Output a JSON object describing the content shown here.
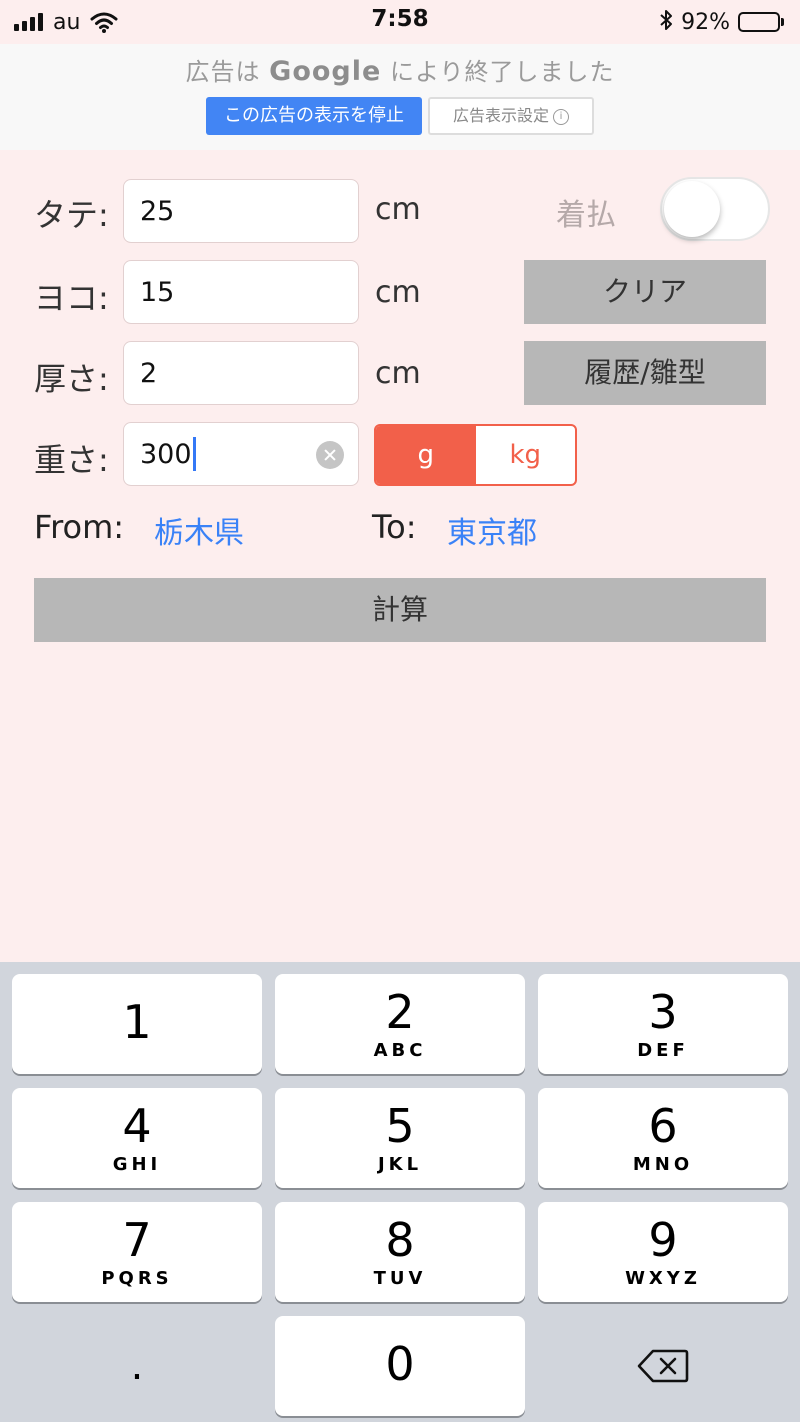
{
  "status_bar": {
    "carrier": "au",
    "time": "7:58",
    "battery_percent": "92%",
    "battery_level": 0.92
  },
  "ad": {
    "message_before": "広告は",
    "brand": "Google",
    "message_after": "により終了しました",
    "stop_button": "この広告の表示を停止",
    "settings_button": "広告表示設定",
    "info_glyph": "i"
  },
  "form": {
    "height": {
      "label": "タテ:",
      "value": "25",
      "unit": "cm"
    },
    "width": {
      "label": "ヨコ:",
      "value": "15",
      "unit": "cm"
    },
    "thickness": {
      "label": "厚さ:",
      "value": "2",
      "unit": "cm"
    },
    "weight": {
      "label": "重さ:",
      "value": "300"
    },
    "cash_on_delivery": {
      "label": "着払",
      "on": false
    },
    "clear_button": "クリア",
    "history_button": "履歴/雛型",
    "unit_toggle": {
      "options": [
        "g",
        "kg"
      ],
      "selected": "g"
    },
    "from_label": "From:",
    "from_value": "栃木県",
    "to_label": "To:",
    "to_value": "東京都",
    "calculate_button": "計算"
  },
  "keypad": {
    "keys": [
      {
        "digit": "1",
        "letters": ""
      },
      {
        "digit": "2",
        "letters": "ABC"
      },
      {
        "digit": "3",
        "letters": "DEF"
      },
      {
        "digit": "4",
        "letters": "GHI"
      },
      {
        "digit": "5",
        "letters": "JKL"
      },
      {
        "digit": "6",
        "letters": "MNO"
      },
      {
        "digit": "7",
        "letters": "PQRS"
      },
      {
        "digit": "8",
        "letters": "TUV"
      },
      {
        "digit": "9",
        "letters": "WXYZ"
      }
    ],
    "dot": ".",
    "zero": "0",
    "delete_icon": "backspace-icon"
  },
  "colors": {
    "background": "#fdeeee",
    "accent_red": "#f2604a",
    "link_blue": "#3a82f7",
    "button_gray": "#b7b7b7",
    "google_blue": "#4285f4"
  }
}
